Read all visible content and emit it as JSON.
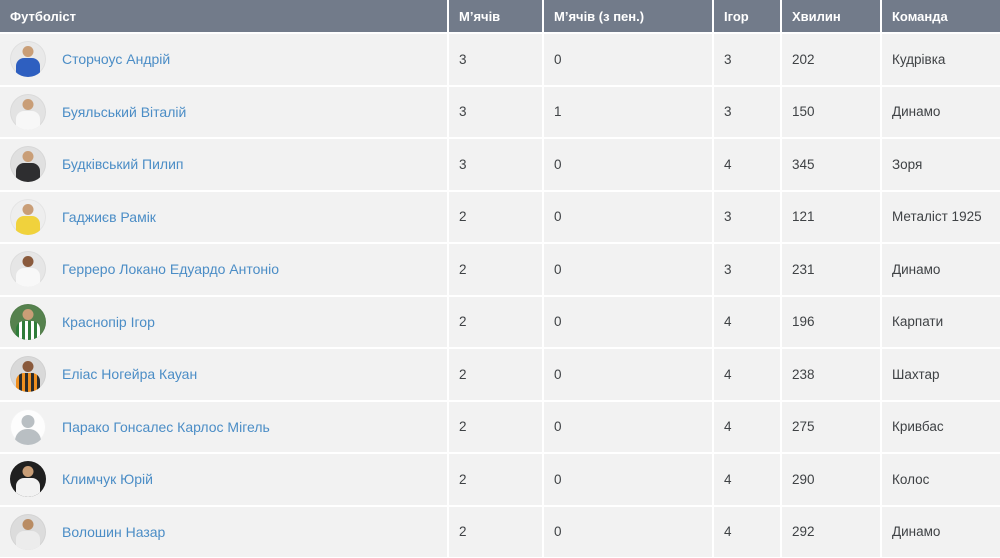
{
  "colors": {
    "header_bg": "#727b8a",
    "header_text": "#ffffff",
    "row_bg": "#f2f2f2",
    "separator": "#ffffff",
    "player_link": "#4b8dc6",
    "cell_text": "#3f4245"
  },
  "table": {
    "columns": [
      {
        "id": "player",
        "label": "Футболіст"
      },
      {
        "id": "goals",
        "label": "М’ячів"
      },
      {
        "id": "penalty_goals",
        "label": "М’ячів (з пен.)"
      },
      {
        "id": "games",
        "label": "Ігор"
      },
      {
        "id": "minutes",
        "label": "Хвилин"
      },
      {
        "id": "team",
        "label": "Команда"
      }
    ],
    "rows": [
      {
        "player": "Сторчоус Андрій",
        "goals": "3",
        "penalty_goals": "0",
        "games": "3",
        "minutes": "202",
        "team": "Кудрівка",
        "avatar": {
          "type": "photo",
          "bg": "#e9e9e9",
          "skin": "#c99e77",
          "jersey": "#2e5fc0"
        }
      },
      {
        "player": "Буяльський Віталій",
        "goals": "3",
        "penalty_goals": "1",
        "games": "3",
        "minutes": "150",
        "team": "Динамо",
        "avatar": {
          "type": "photo",
          "bg": "#e3e3e3",
          "skin": "#c99e77",
          "jersey": "#f7f7f7"
        }
      },
      {
        "player": "Будківський Пилип",
        "goals": "3",
        "penalty_goals": "0",
        "games": "4",
        "minutes": "345",
        "team": "Зоря",
        "avatar": {
          "type": "photo",
          "bg": "#e0e0e0",
          "skin": "#c99e77",
          "jersey": "#2e2e30"
        }
      },
      {
        "player": "Гаджиєв Рамік",
        "goals": "2",
        "penalty_goals": "0",
        "games": "3",
        "minutes": "121",
        "team": "Металіст 1925",
        "avatar": {
          "type": "photo",
          "bg": "#eeeeee",
          "skin": "#c99e77",
          "jersey": "#f0d23c"
        }
      },
      {
        "player": "Герреро Локано Едуардо Антоніо",
        "goals": "2",
        "penalty_goals": "0",
        "games": "3",
        "minutes": "231",
        "team": "Динамо",
        "avatar": {
          "type": "photo",
          "bg": "#e6e6e6",
          "skin": "#8a5a3c",
          "jersey": "#f8f8f8"
        }
      },
      {
        "player": "Краснопір Ігор",
        "goals": "2",
        "penalty_goals": "0",
        "games": "4",
        "minutes": "196",
        "team": "Карпати",
        "avatar": {
          "type": "photo",
          "bg": "#56824e",
          "skin": "#c99e77",
          "stripes": [
            "#2f7d3a",
            "#ffffff"
          ]
        }
      },
      {
        "player": "Еліас Ногейра Кауан",
        "goals": "2",
        "penalty_goals": "0",
        "games": "4",
        "minutes": "238",
        "team": "Шахтар",
        "avatar": {
          "type": "photo",
          "bg": "#d9d9d9",
          "skin": "#8a5a3c",
          "stripes": [
            "#ef8f1f",
            "#2b2b2b"
          ]
        }
      },
      {
        "player": "Парако Гонсалес Карлос Мігель",
        "goals": "2",
        "penalty_goals": "0",
        "games": "4",
        "minutes": "275",
        "team": "Кривбас",
        "avatar": {
          "type": "placeholder",
          "bg": "#fdfdfd",
          "skin": "#b9bfc3",
          "jersey": "#b9bfc3"
        }
      },
      {
        "player": "Климчук Юрій",
        "goals": "2",
        "penalty_goals": "0",
        "games": "4",
        "minutes": "290",
        "team": "Колос",
        "avatar": {
          "type": "photo",
          "bg": "#202020",
          "skin": "#c99e77",
          "jersey": "#f2f2f2"
        }
      },
      {
        "player": "Волошин Назар",
        "goals": "2",
        "penalty_goals": "0",
        "games": "4",
        "minutes": "292",
        "team": "Динамо",
        "avatar": {
          "type": "photo",
          "bg": "#dcdcdc",
          "skin": "#b98c63",
          "jersey": "#ececec"
        }
      }
    ]
  }
}
